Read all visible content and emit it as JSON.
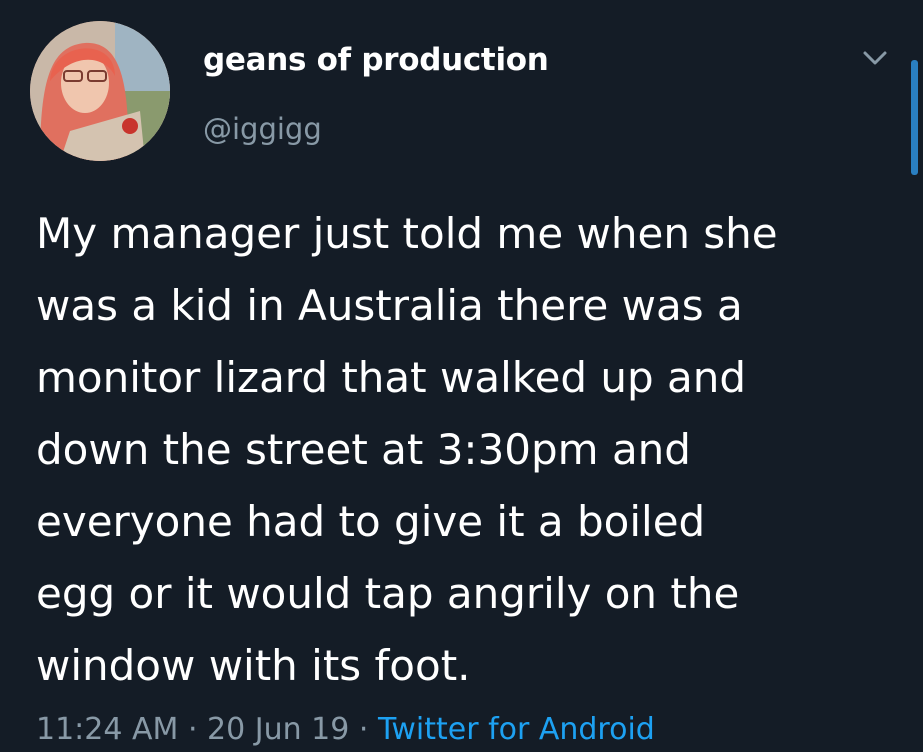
{
  "user": {
    "display_name": "geans of production",
    "handle": "@iggigg"
  },
  "tweet": {
    "lines": [
      "My manager just told me when she",
      "was a kid in Australia there was a",
      "monitor lizard that walked up and",
      "down the street at 3:30pm and",
      "everyone had to give it a boiled",
      "egg or it would tap angrily on the",
      "window with its foot."
    ]
  },
  "meta": {
    "time": "11:24 AM",
    "separator": "·",
    "date": "20 Jun 19",
    "source": "Twitter for Android"
  },
  "colors": {
    "background": "#141c26",
    "text": "#ffffff",
    "secondary": "#8899a6",
    "link": "#1da1f2"
  },
  "icons": {
    "menu": "chevron-down-icon"
  }
}
